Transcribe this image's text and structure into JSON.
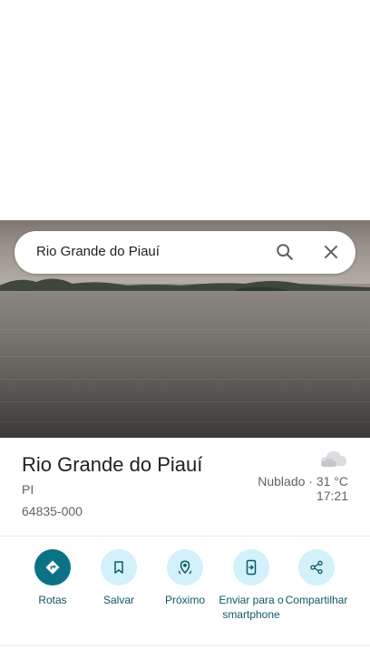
{
  "search": {
    "query": "Rio Grande do Piauí"
  },
  "place": {
    "name": "Rio Grande do Piauí",
    "state": "PI",
    "postal_code": "64835-000"
  },
  "weather": {
    "summary": "Nublado · 31 °C",
    "time": "17:21",
    "icon": "cloud-icon"
  },
  "actions": [
    {
      "label": "Rotas",
      "icon": "directions-icon"
    },
    {
      "label": "Salvar",
      "icon": "bookmark-icon"
    },
    {
      "label": "Próximo",
      "icon": "nearby-icon"
    },
    {
      "label": "Enviar para o smartphone",
      "icon": "send-to-phone-icon"
    },
    {
      "label": "Compartilhar",
      "icon": "share-icon"
    }
  ],
  "colors": {
    "accent": "#0b7285",
    "action_bg": "#d2f1fa",
    "action_text": "#0b5966"
  }
}
